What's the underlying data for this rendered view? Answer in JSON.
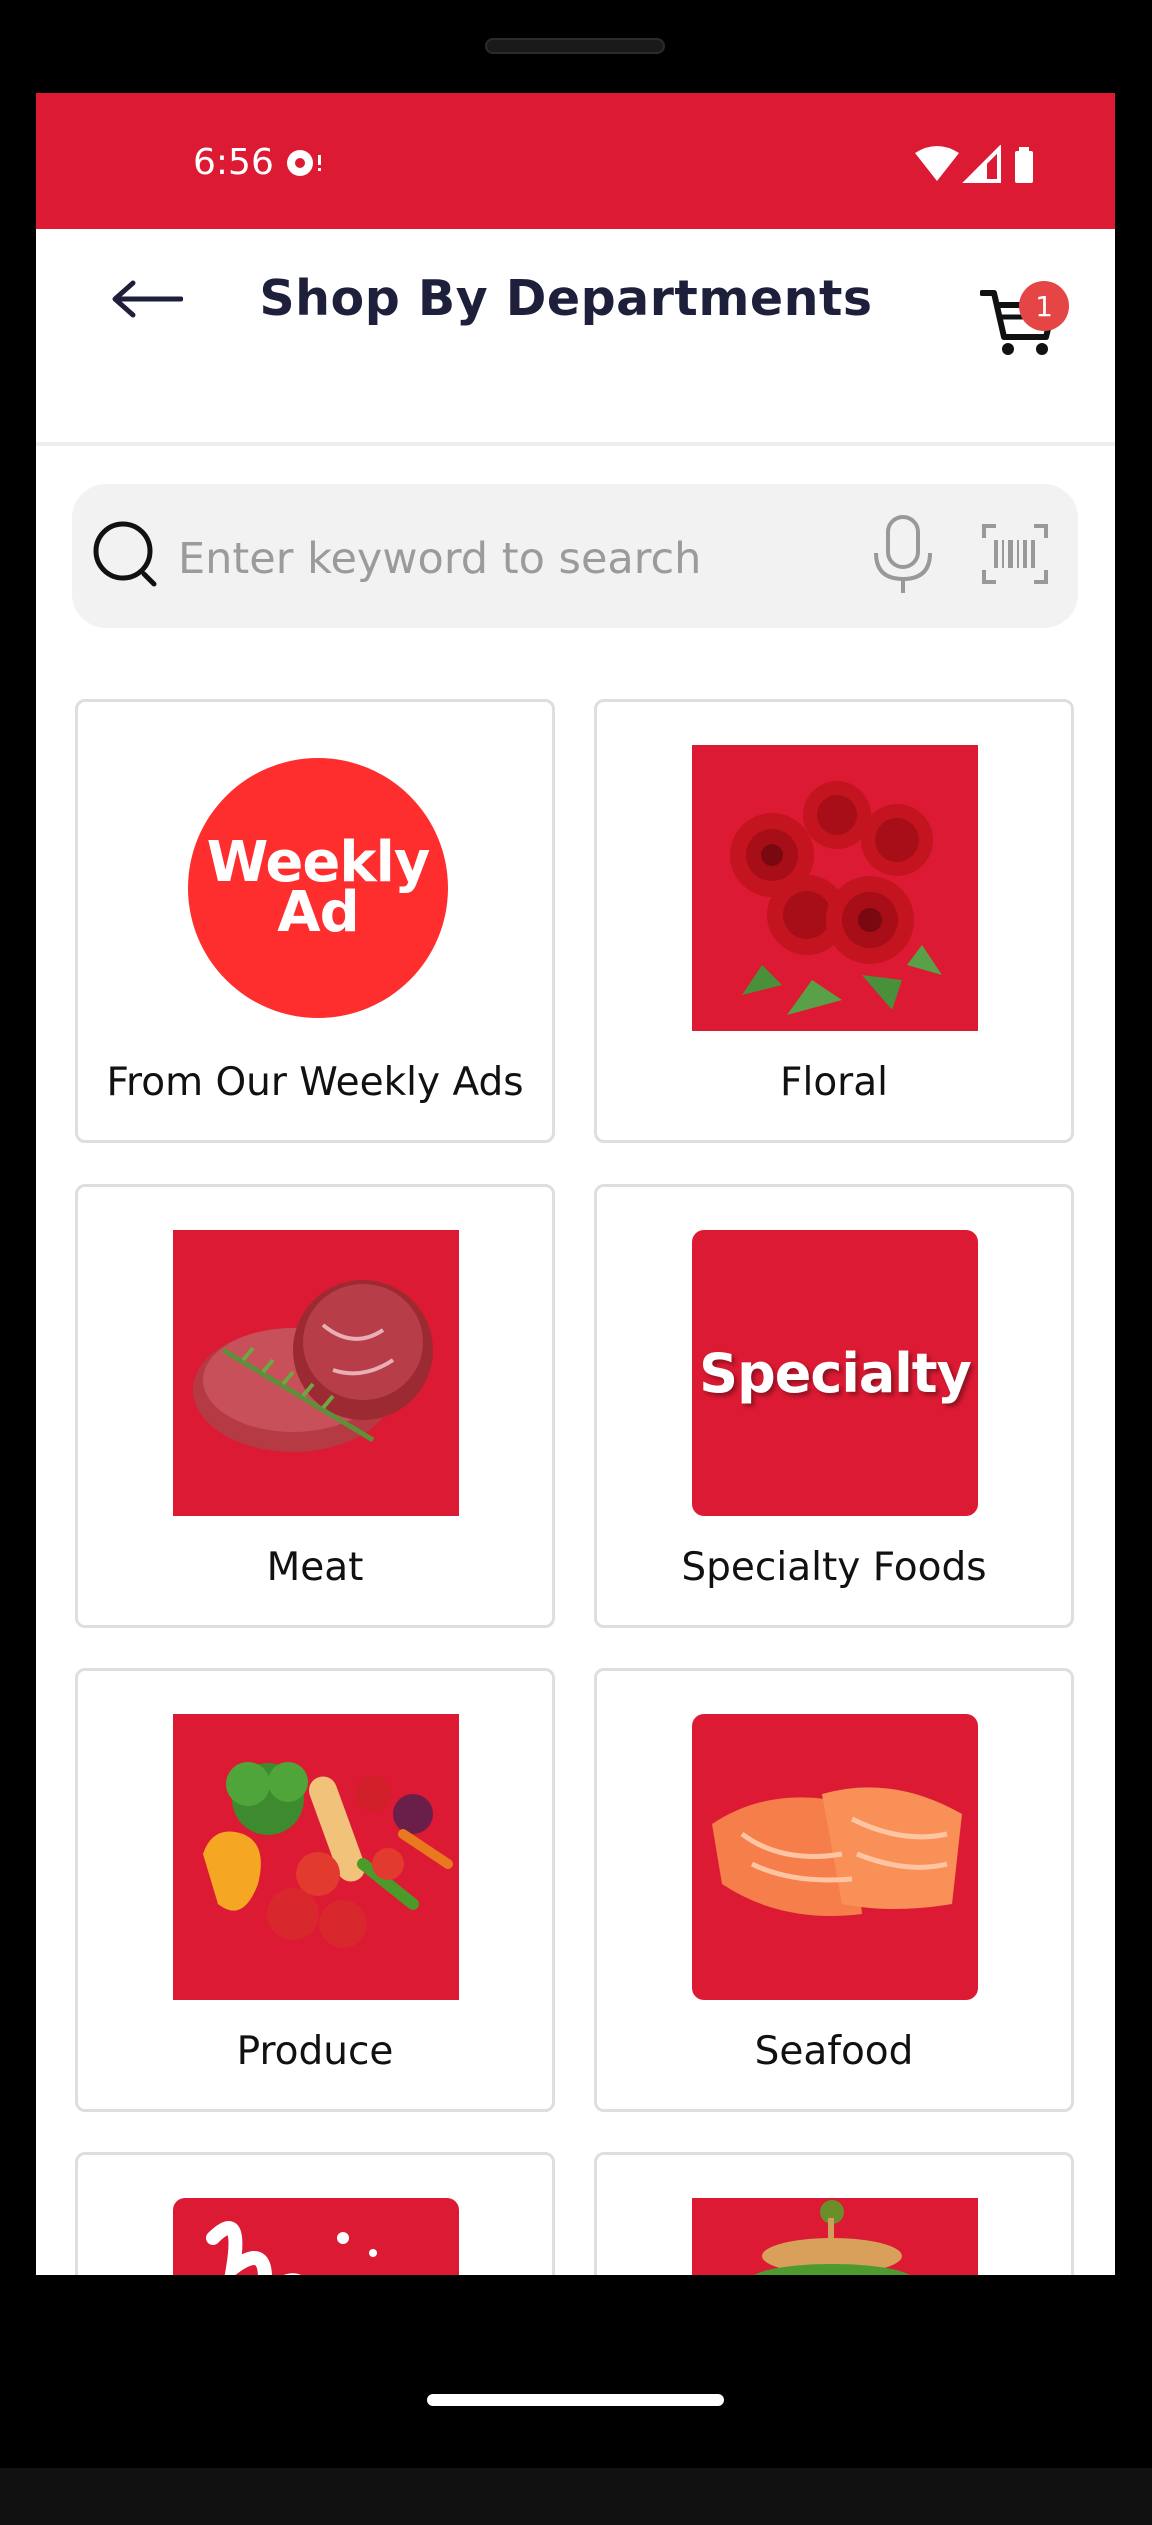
{
  "status_bar": {
    "time": "6:56"
  },
  "header": {
    "title": "Shop By Departments",
    "cart_count": "1"
  },
  "search": {
    "placeholder": "Enter keyword to search"
  },
  "departments": [
    {
      "label": "From Our Weekly Ads",
      "image_text_line1": "Weekly",
      "image_text_line2": "Ad"
    },
    {
      "label": "Floral"
    },
    {
      "label": "Meat"
    },
    {
      "label": "Specialty Foods",
      "image_text": "Specialty"
    },
    {
      "label": "Produce"
    },
    {
      "label": "Seafood"
    },
    {
      "label": ""
    },
    {
      "label": ""
    }
  ],
  "colors": {
    "brand_red": "#dc1a33",
    "title_navy": "#1e1f3b",
    "badge_red": "#e64545"
  }
}
